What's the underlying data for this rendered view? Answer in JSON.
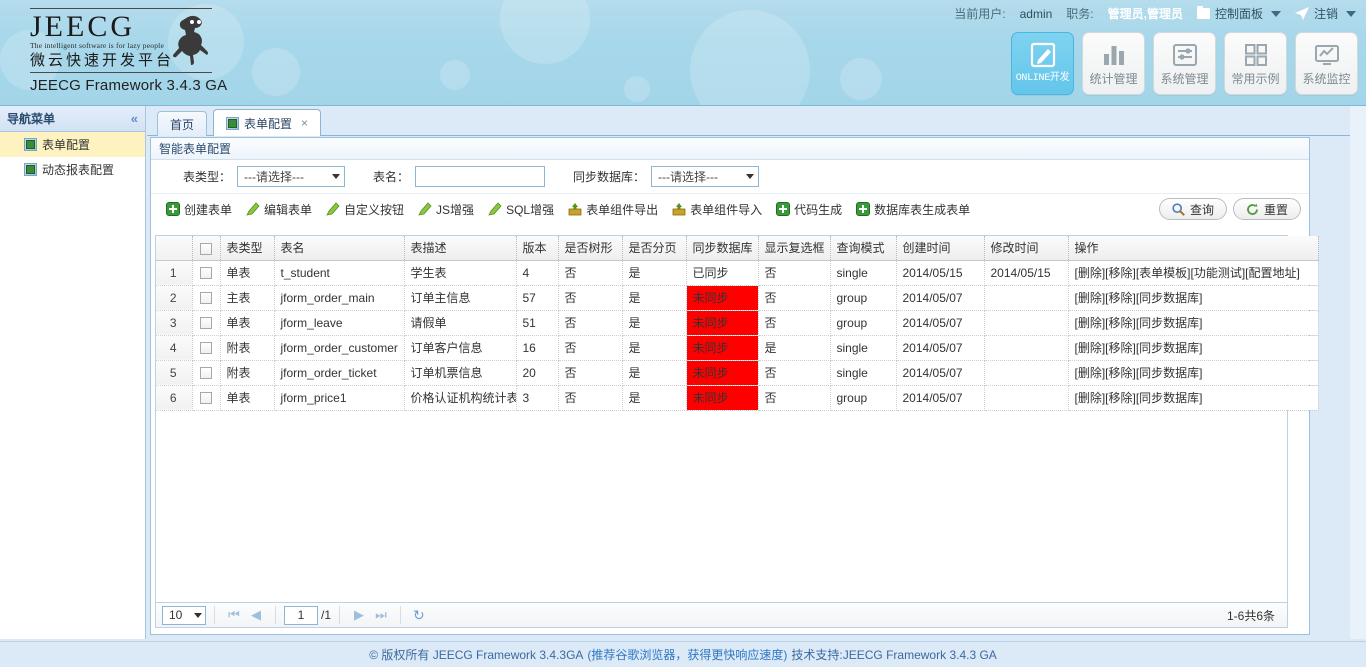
{
  "header": {
    "logo_word": "JEECG",
    "logo_tagline": "The intelligent software is for lazy people",
    "logo_cn": "微云快速开发平台",
    "version_line": "JEECG Framework 3.4.3 GA",
    "current_user_label": "当前用户:",
    "current_user": "admin",
    "role_label": "职务:",
    "role": "管理员,管理员",
    "control_panel": "控制面板",
    "logout": "注销",
    "nav_buttons": [
      {
        "label": "ONLINE开发",
        "icon": "pencil-square-icon",
        "active": true
      },
      {
        "label": "统计管理",
        "icon": "bar-chart-icon",
        "active": false
      },
      {
        "label": "系统管理",
        "icon": "sliders-icon",
        "active": false
      },
      {
        "label": "常用示例",
        "icon": "grid-squares-icon",
        "active": false
      },
      {
        "label": "系统监控",
        "icon": "monitor-chart-icon",
        "active": false
      }
    ]
  },
  "sidebar": {
    "title": "导航菜单",
    "collapse_icon": "chevron-double-left-icon",
    "items": [
      {
        "label": "表单配置",
        "selected": true
      },
      {
        "label": "动态报表配置",
        "selected": false
      }
    ]
  },
  "tabs": [
    {
      "label": "首页",
      "active": false,
      "closable": false,
      "has_icon": false
    },
    {
      "label": "表单配置",
      "active": true,
      "closable": true,
      "has_icon": true,
      "close_label": "×"
    }
  ],
  "panel": {
    "title": "智能表单配置",
    "filters": [
      {
        "label": "表类型：",
        "type": "select",
        "value": "---请选择---"
      },
      {
        "label": "表名：",
        "type": "text",
        "value": "",
        "placeholder": ""
      },
      {
        "label": "同步数据库：",
        "type": "select",
        "value": "---请选择---"
      }
    ],
    "actions": [
      {
        "label": "创建表单",
        "icon": "plus-icon"
      },
      {
        "label": "编辑表单",
        "icon": "pencil-icon"
      },
      {
        "label": "自定义按钮",
        "icon": "pencil-icon"
      },
      {
        "label": "JS增强",
        "icon": "pencil-icon"
      },
      {
        "label": "SQL增强",
        "icon": "pencil-icon"
      },
      {
        "label": "表单组件导出",
        "icon": "export-icon"
      },
      {
        "label": "表单组件导入",
        "icon": "export-icon"
      },
      {
        "label": "代码生成",
        "icon": "plus-icon"
      },
      {
        "label": "数据库表生成表单",
        "icon": "plus-icon"
      }
    ],
    "buttons": [
      {
        "label": "查询",
        "icon": "search-icon"
      },
      {
        "label": "重置",
        "icon": "refresh-icon"
      }
    ]
  },
  "grid": {
    "columns": [
      "表类型",
      "表名",
      "表描述",
      "版本",
      "是否树形",
      "是否分页",
      "同步数据库",
      "显示复选框",
      "查询模式",
      "创建时间",
      "修改时间",
      "操作"
    ],
    "rows": [
      {
        "n": "1",
        "type": "单表",
        "name": "t_student",
        "desc": "学生表",
        "ver": "4",
        "tree": "否",
        "page": "是",
        "sync": "已同步",
        "sync_alert": false,
        "checkbox": "否",
        "mode": "single",
        "created": "2014/05/15",
        "modified": "2014/05/15",
        "ops": "[删除][移除][表单模板][功能测试][配置地址]"
      },
      {
        "n": "2",
        "type": "主表",
        "name": "jform_order_main",
        "desc": "订单主信息",
        "ver": "57",
        "tree": "否",
        "page": "是",
        "sync": "未同步",
        "sync_alert": true,
        "checkbox": "否",
        "mode": "group",
        "created": "2014/05/07",
        "modified": "",
        "ops": "[删除][移除][同步数据库]"
      },
      {
        "n": "3",
        "type": "单表",
        "name": "jform_leave",
        "desc": "请假单",
        "ver": "51",
        "tree": "否",
        "page": "是",
        "sync": "未同步",
        "sync_alert": true,
        "checkbox": "否",
        "mode": "group",
        "created": "2014/05/07",
        "modified": "",
        "ops": "[删除][移除][同步数据库]"
      },
      {
        "n": "4",
        "type": "附表",
        "name": "jform_order_customer",
        "desc": "订单客户信息",
        "ver": "16",
        "tree": "否",
        "page": "是",
        "sync": "未同步",
        "sync_alert": true,
        "checkbox": "是",
        "mode": "single",
        "created": "2014/05/07",
        "modified": "",
        "ops": "[删除][移除][同步数据库]"
      },
      {
        "n": "5",
        "type": "附表",
        "name": "jform_order_ticket",
        "desc": "订单机票信息",
        "ver": "20",
        "tree": "否",
        "page": "是",
        "sync": "未同步",
        "sync_alert": true,
        "checkbox": "否",
        "mode": "single",
        "created": "2014/05/07",
        "modified": "",
        "ops": "[删除][移除][同步数据库]"
      },
      {
        "n": "6",
        "type": "单表",
        "name": "jform_price1",
        "desc": "价格认证机构统计表",
        "ver": "3",
        "tree": "否",
        "page": "是",
        "sync": "未同步",
        "sync_alert": true,
        "checkbox": "否",
        "mode": "group",
        "created": "2014/05/07",
        "modified": "",
        "ops": "[删除][移除][同步数据库]"
      }
    ]
  },
  "pager": {
    "page_size": "10",
    "first_icon": "first-page-icon",
    "prev_icon": "prev-page-icon",
    "next_icon": "next-page-icon",
    "last_icon": "last-page-icon",
    "refresh_icon": "refresh-icon",
    "current_page": "1",
    "total_pages": "/1",
    "summary": "1-6共6条"
  },
  "footer": {
    "copyright": "© 版权所有 JEECG Framework 3.4.3GA",
    "note": "(推荐谷歌浏览器，获得更快响应速度)",
    "support": "技术支持:JEECG Framework 3.4.3 GA"
  },
  "colors": {
    "header_bg": "#a7d7ea",
    "accent": "#63c6ea",
    "alert_red": "#fe0000",
    "selected_menu": "#fdf2c0",
    "body_bg": "#dce9f7"
  }
}
